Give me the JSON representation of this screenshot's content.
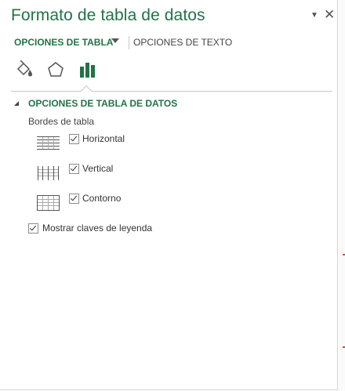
{
  "pane": {
    "title": "Formato de tabla de datos",
    "pin_icon": "caret-down-icon",
    "close_icon": "close-icon"
  },
  "tabs": {
    "active": "OPCIONES DE TABLA",
    "other": "OPCIONES DE TEXTO"
  },
  "icon_tabs": [
    "fill-line-icon",
    "effects-pentagon-icon",
    "table-options-chart-icon"
  ],
  "section": {
    "title": "OPCIONES DE TABLA DE DATOS",
    "borders_label": "Bordes de tabla",
    "options": [
      {
        "label": "Horizontal",
        "checked": true,
        "icon": "horizontal-borders-icon"
      },
      {
        "label": "Vertical",
        "checked": true,
        "icon": "vertical-borders-icon"
      },
      {
        "label": "Contorno",
        "checked": true,
        "icon": "outline-borders-icon"
      }
    ],
    "legend_keys": {
      "label": "Mostrar claves de leyenda",
      "checked": true
    }
  },
  "colors": {
    "accent": "#217346",
    "text": "#444444",
    "border": "#c8c8c8"
  }
}
